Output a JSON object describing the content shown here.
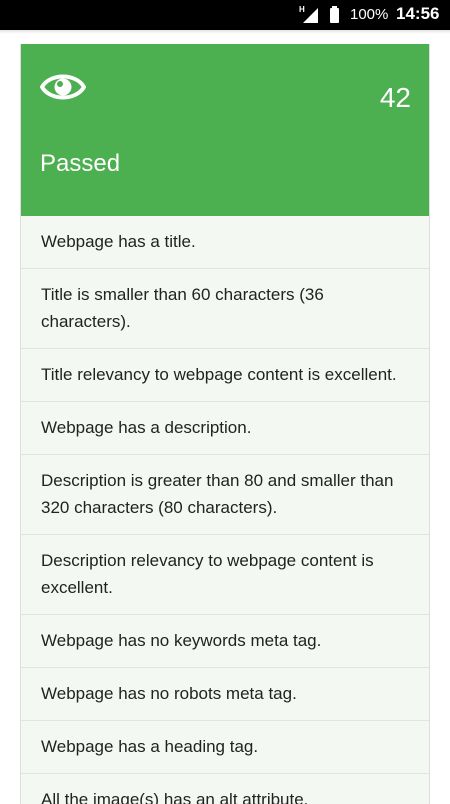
{
  "status_bar": {
    "network_type": "H",
    "battery_percent": "100%",
    "time": "14:56"
  },
  "card": {
    "icon": "eye-icon",
    "count": "42",
    "title": "Passed",
    "header_color": "#4caf50",
    "items": [
      "Webpage has a title.",
      "Title is smaller than 60 characters (36 characters).",
      "Title relevancy to webpage content is excellent.",
      "Webpage has a description.",
      "Description is greater than 80 and smaller than 320 characters (80 characters).",
      "Description relevancy to webpage content is excellent.",
      "Webpage has no keywords meta tag.",
      "Webpage has no robots meta tag.",
      "Webpage has a heading tag.",
      "All the image(s) has an alt attribute."
    ]
  }
}
